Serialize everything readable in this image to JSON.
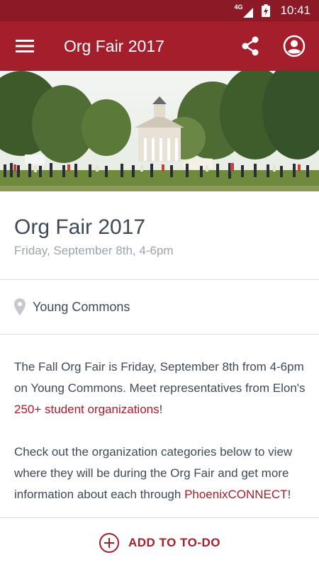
{
  "status_bar": {
    "network": "4G",
    "time": "10:41",
    "icons": [
      "signal-icon",
      "battery-charging-icon"
    ]
  },
  "app_bar": {
    "title": "Org Fair 2017",
    "icons": [
      "menu-icon",
      "share-icon",
      "account-icon"
    ]
  },
  "hero": {
    "description_icon": "campus-photo"
  },
  "event": {
    "title": "Org Fair 2017",
    "date": "Friday, September 8th, 4-6pm",
    "location": "Young Commons"
  },
  "description": {
    "p1_text": "The Fall Org Fair is Friday, September 8th from 4-6pm on Young Commons. Meet representatives from Elon's ",
    "p1_link": "250+ student organizations",
    "p1_end": "!",
    "p2_text": "Check out the organization categories below to view where they will be during the Org Fair and get more information about each through ",
    "p2_link": "PhoenixCONNECT",
    "p2_end": "!"
  },
  "actions": {
    "add_label": "ADD TO TO-DO"
  },
  "colors": {
    "brand": "#a41e2c",
    "status_bar": "#8b1a26",
    "text": "#3f4a57",
    "muted": "#9aa3ad"
  }
}
